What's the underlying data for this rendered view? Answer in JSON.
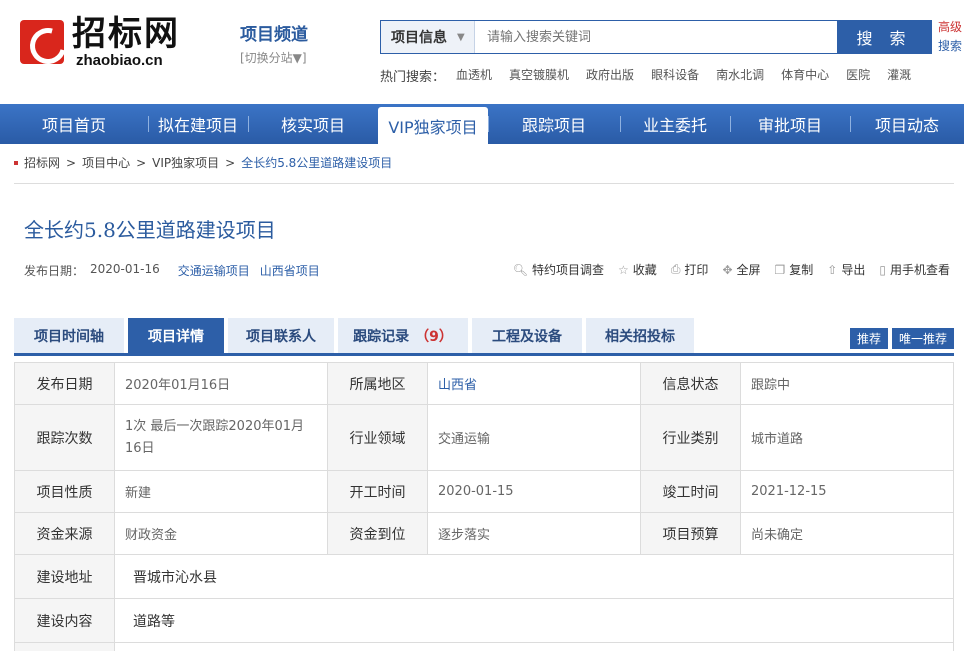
{
  "logo": {
    "cn": "招标网",
    "en": "zhaobiao.cn"
  },
  "channel": {
    "title": "项目频道",
    "switch": "[切换分站▼]"
  },
  "search": {
    "category": "项目信息",
    "placeholder": "请输入搜索关键词",
    "button": "搜 索",
    "advanced_1": "高级",
    "advanced_2": "搜索"
  },
  "hot": {
    "label": "热门搜索：",
    "items": [
      "血透机",
      "真空镀膜机",
      "政府出版",
      "眼科设备",
      "南水北调",
      "体育中心",
      "医院",
      "灌溉"
    ]
  },
  "nav": [
    "项目首页",
    "拟在建项目",
    "核实项目",
    "VIP独家项目",
    "跟踪项目",
    "业主委托",
    "审批项目",
    "项目动态"
  ],
  "breadcrumb": [
    "招标网",
    "项目中心",
    "VIP独家项目",
    "全长约5.8公里道路建设项目"
  ],
  "project": {
    "title": "全长约5.8公里道路建设项目",
    "date_label": "发布日期：",
    "date": "2020-01-16",
    "tag1": "交通运输项目",
    "tag2": "山西省项目"
  },
  "tools": [
    "特约项目调查",
    "收藏",
    "打印",
    "全屏",
    "复制",
    "导出",
    "用手机查看"
  ],
  "tabs": {
    "items": [
      "项目时间轴",
      "项目详情",
      "项目联系人",
      "跟踪记录",
      "工程及设备",
      "相关招投标"
    ],
    "track_count": "（9）",
    "btn1": "推荐",
    "btn2": "唯一推荐"
  },
  "details": {
    "r1": [
      "发布日期",
      "2020年01月16日",
      "所属地区",
      "山西省",
      "信息状态",
      "跟踪中"
    ],
    "r2": [
      "跟踪次数",
      "1次  最后一次跟踪2020年01月16日",
      "行业领域",
      "交通运输",
      "行业类别",
      "城市道路"
    ],
    "r3": [
      "项目性质",
      "新建",
      "开工时间",
      "2020-01-15",
      "竣工时间",
      "2021-12-15"
    ],
    "r4": [
      "资金来源",
      "财政资金",
      "资金到位",
      "逐步落实",
      "项目预算",
      "尚未确定"
    ],
    "r5": [
      "建设地址",
      "晋城市沁水县"
    ],
    "r6": [
      "建设内容",
      "道路等"
    ]
  }
}
